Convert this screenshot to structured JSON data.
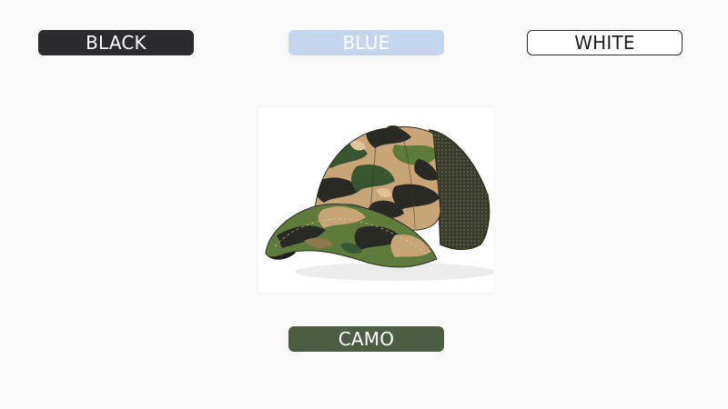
{
  "colors": {
    "background": "#f9f9f9",
    "black_swatch": "#2b2b2d",
    "blue_swatch": "#c5d5ec",
    "white_swatch": "#ffffff",
    "camo_swatch": "#4b5d45"
  },
  "options": {
    "black": "BLACK",
    "blue": "BLUE",
    "white": "WHITE",
    "camo": "CAMO"
  },
  "product_image": {
    "icon": "camo-baseball-cap-image"
  }
}
